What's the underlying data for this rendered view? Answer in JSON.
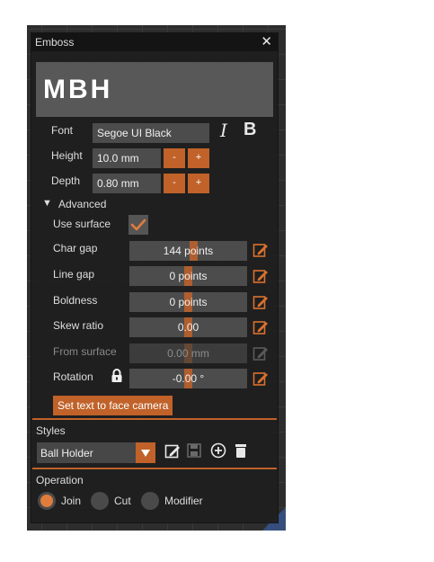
{
  "window": {
    "title": "Emboss",
    "close_glyph": "✕"
  },
  "preview": {
    "text": "MBH"
  },
  "font": {
    "label": "Font",
    "value": "Segoe UI Black",
    "italic_label": "I",
    "bold_label": "B"
  },
  "height": {
    "label": "Height",
    "value": "10.0 mm",
    "minus": "-",
    "plus": "+"
  },
  "depth": {
    "label": "Depth",
    "value": "0.80 mm",
    "minus": "-",
    "plus": "+"
  },
  "advanced": {
    "header_arrow": "▼",
    "header": "Advanced",
    "use_surface": {
      "label": "Use surface",
      "checked": true
    },
    "char_gap": {
      "label": "Char gap",
      "value": "144 points",
      "level": 0.55
    },
    "line_gap": {
      "label": "Line gap",
      "value": "0 points",
      "level": 0.5
    },
    "boldness": {
      "label": "Boldness",
      "value": "0 points",
      "level": 0.5
    },
    "skew_ratio": {
      "label": "Skew ratio",
      "value": "0.00",
      "level": 0.5
    },
    "from_surface": {
      "label": "From surface",
      "value": "0.00 mm",
      "level": 0.5,
      "disabled": true
    },
    "rotation": {
      "label": "Rotation",
      "value": "-0.00 °",
      "level": 0.5,
      "locked": true
    },
    "face_camera_button": "Set text to face camera"
  },
  "styles": {
    "header": "Styles",
    "selected": "Ball Holder",
    "icons": [
      "edit-icon",
      "save-icon",
      "add-icon",
      "delete-icon"
    ]
  },
  "operation": {
    "header": "Operation",
    "options": [
      {
        "label": "Join",
        "selected": true
      },
      {
        "label": "Cut",
        "selected": false
      },
      {
        "label": "Modifier",
        "selected": false
      }
    ]
  },
  "colors": {
    "accent": "#c0622a",
    "panel_bg": "#1e1e1e",
    "field_bg": "#4c4c4c",
    "title_bg": "#141414"
  }
}
